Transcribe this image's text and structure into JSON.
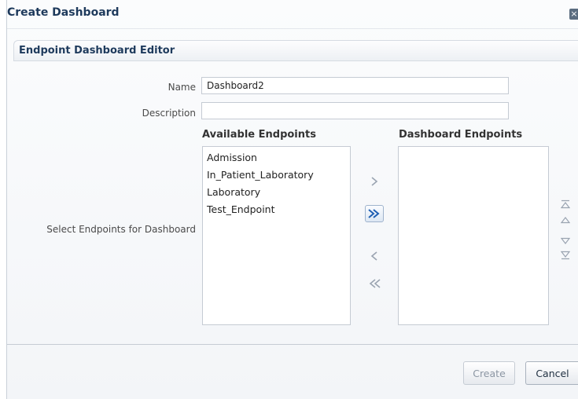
{
  "dialog": {
    "title": "Create Dashboard",
    "close_glyph": "×"
  },
  "panel": {
    "header": "Endpoint Dashboard Editor"
  },
  "form": {
    "name_label": "Name",
    "name_value": "Dashboard2",
    "description_label": "Description",
    "description_value": "",
    "select_label": "Select Endpoints for Dashboard"
  },
  "shuttle": {
    "available_header": "Available Endpoints",
    "selected_header": "Dashboard Endpoints",
    "available_items": [
      "Admission",
      "In_Patient_Laboratory",
      "Laboratory",
      "Test_Endpoint"
    ],
    "selected_items": []
  },
  "icons": {
    "move": "chevron-right-icon",
    "move_all": "double-chevron-right-icon",
    "remove": "chevron-left-icon",
    "remove_all": "double-chevron-left-icon",
    "move_top": "move-to-top-icon",
    "move_up": "move-up-icon",
    "move_down": "move-down-icon",
    "move_bottom": "move-to-bottom-icon"
  },
  "colors": {
    "accent": "#1e3a5c",
    "active_icon": "#1e5fb3",
    "disabled_icon": "#9aa4b1"
  },
  "buttons": {
    "create": "Create",
    "cancel": "Cancel"
  }
}
